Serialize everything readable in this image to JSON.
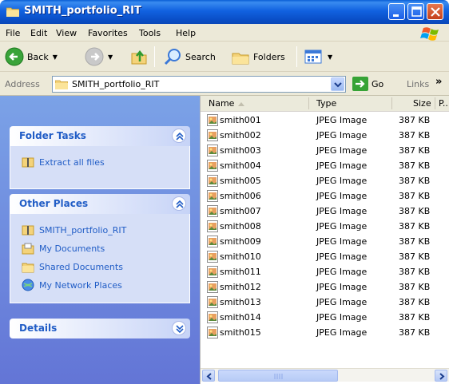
{
  "window": {
    "title": "SMITH_portfolio_RIT",
    "icon": "folder-icon"
  },
  "menu": {
    "items": [
      "File",
      "Edit",
      "View",
      "Favorites",
      "Tools",
      "Help"
    ]
  },
  "toolbar": {
    "back_label": "Back",
    "search_label": "Search",
    "folders_label": "Folders"
  },
  "address": {
    "label": "Address",
    "value": "SMITH_portfolio_RIT",
    "go_label": "Go",
    "links_label": "Links",
    "more_label": "»"
  },
  "taskpane": {
    "folder_tasks": {
      "title": "Folder Tasks",
      "items": [
        "Extract all files"
      ]
    },
    "other_places": {
      "title": "Other Places",
      "items": [
        "SMITH_portfolio_RIT",
        "My Documents",
        "Shared Documents",
        "My Network Places"
      ]
    },
    "details": {
      "title": "Details"
    }
  },
  "filelist": {
    "columns": {
      "name": "Name",
      "type": "Type",
      "size": "Size",
      "partial": "P..."
    },
    "rows": [
      {
        "name": "smith001",
        "type": "JPEG Image",
        "size": "387 KB"
      },
      {
        "name": "smith002",
        "type": "JPEG Image",
        "size": "387 KB"
      },
      {
        "name": "smith003",
        "type": "JPEG Image",
        "size": "387 KB"
      },
      {
        "name": "smith004",
        "type": "JPEG Image",
        "size": "387 KB"
      },
      {
        "name": "smith005",
        "type": "JPEG Image",
        "size": "387 KB"
      },
      {
        "name": "smith006",
        "type": "JPEG Image",
        "size": "387 KB"
      },
      {
        "name": "smith007",
        "type": "JPEG Image",
        "size": "387 KB"
      },
      {
        "name": "smith008",
        "type": "JPEG Image",
        "size": "387 KB"
      },
      {
        "name": "smith009",
        "type": "JPEG Image",
        "size": "387 KB"
      },
      {
        "name": "smith010",
        "type": "JPEG Image",
        "size": "387 KB"
      },
      {
        "name": "smith011",
        "type": "JPEG Image",
        "size": "387 KB"
      },
      {
        "name": "smith012",
        "type": "JPEG Image",
        "size": "387 KB"
      },
      {
        "name": "smith013",
        "type": "JPEG Image",
        "size": "387 KB"
      },
      {
        "name": "smith014",
        "type": "JPEG Image",
        "size": "387 KB"
      },
      {
        "name": "smith015",
        "type": "JPEG Image",
        "size": "387 KB"
      }
    ]
  },
  "colors": {
    "titlebar": "#0a5fd6",
    "taskpane": "#7ba2e7",
    "panel_title": "#215dc6",
    "close_button": "#c4401b"
  }
}
